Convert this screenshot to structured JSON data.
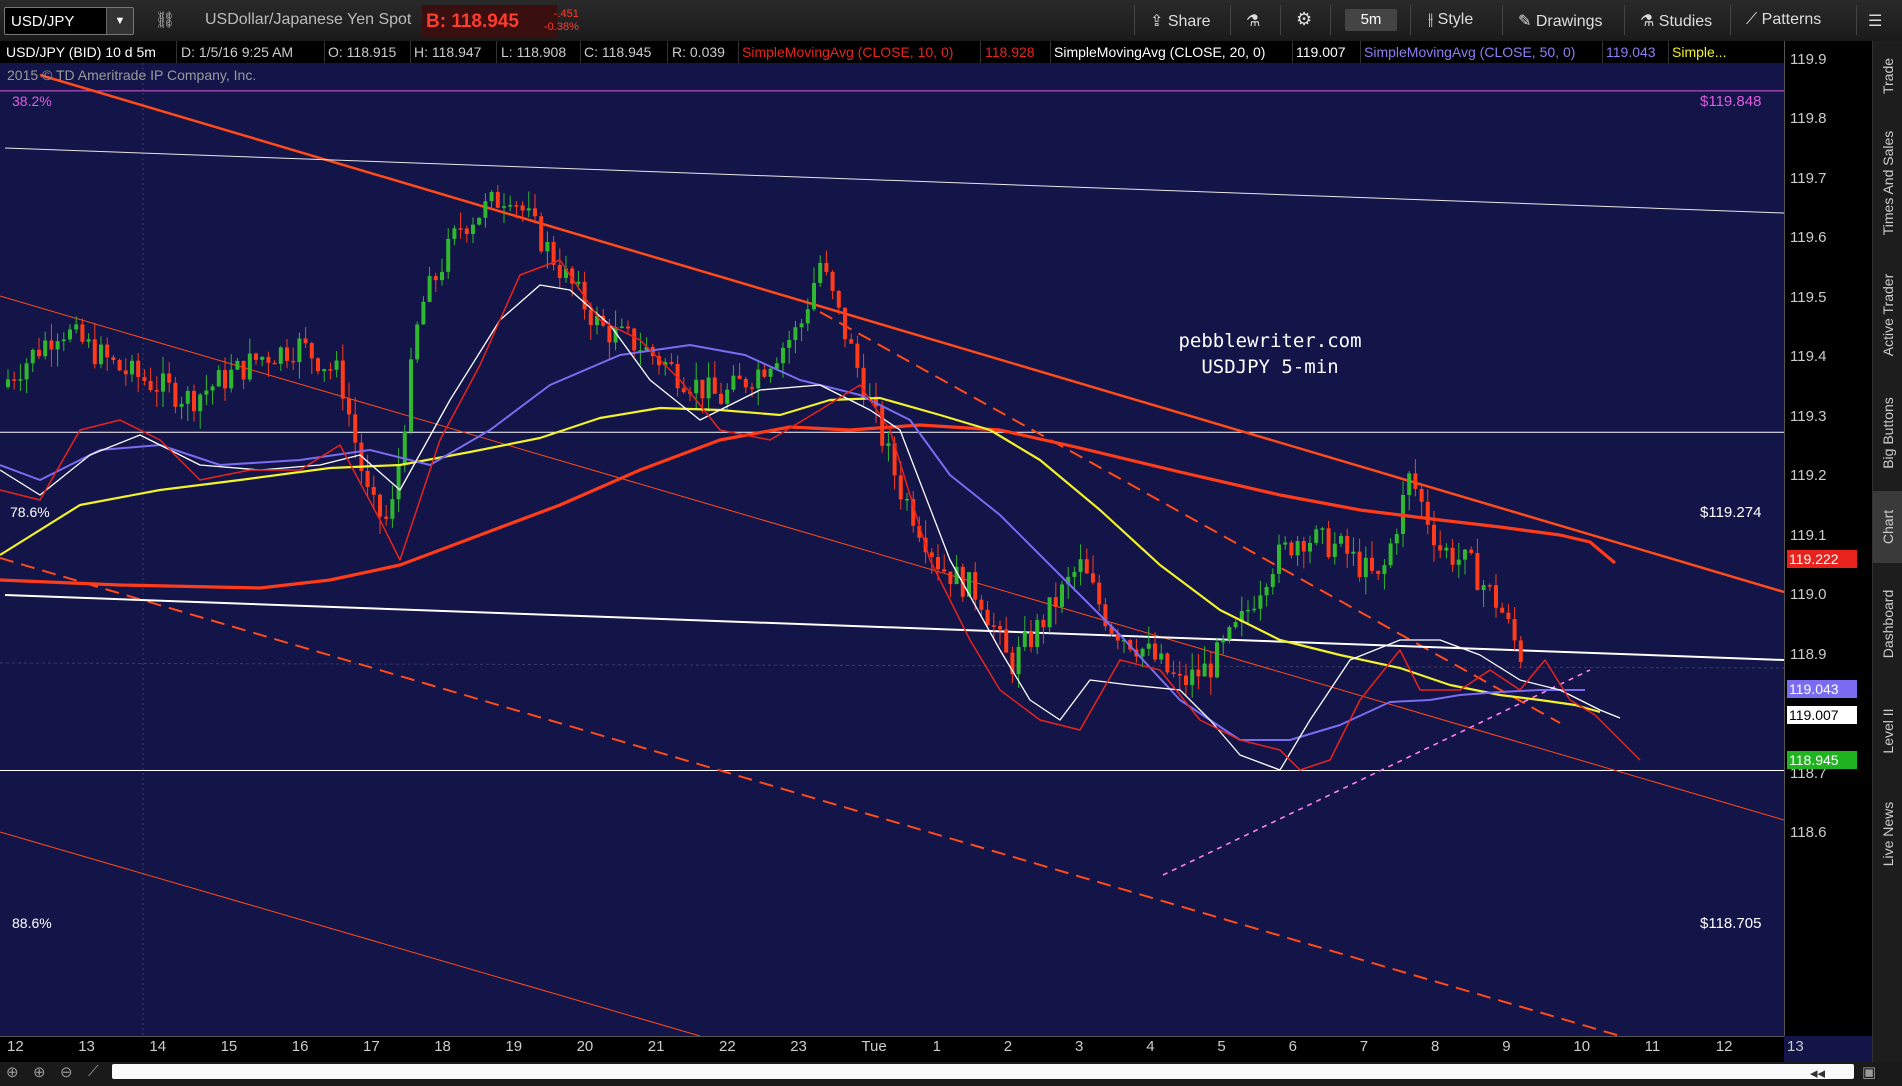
{
  "toolbar": {
    "symbol": "USD/JPY",
    "description": "USDollar/Japanese Yen Spot",
    "bid": "B: 118.945",
    "net_change": "-.451",
    "pct_change": "-0.38%",
    "share_label": "Share",
    "timeframe": "5m",
    "style_label": "Style",
    "drawings_label": "Drawings",
    "studies_label": "Studies",
    "patterns_label": "Patterns"
  },
  "info": {
    "title": "USD/JPY (BID) 10 d 5m",
    "date": "D: 1/5/16 9:25 AM",
    "open": "O: 118.915",
    "high": "H: 118.947",
    "low": "L: 118.908",
    "close": "C: 118.945",
    "range": "R: 0.039",
    "sma10_label": "SimpleMovingAvg (CLOSE, 10, 0)",
    "sma10_value": "118.928",
    "sma20_label": "SimpleMovingAvg (CLOSE, 20, 0)",
    "sma20_value": "119.007",
    "sma50_label": "SimpleMovingAvg (CLOSE, 50, 0)",
    "sma50_value": "119.043",
    "sma_more": "Simple..."
  },
  "chart": {
    "copyright": "2015 © TD Ameritrade IP Company, Inc.",
    "watermark_line1": "pebblewriter.com",
    "watermark_line2": "USDJPY 5-min",
    "fib_382_label": "38.2%",
    "fib_382_price": "$119.848",
    "fib_786_label": "78.6%",
    "fib_786_price": "$119.274",
    "fib_886_label": "88.6%",
    "fib_886_price": "$118.705"
  },
  "price_badges": {
    "sma200": "119.222",
    "sma50": "119.043",
    "sma20": "119.007",
    "last": "118.945"
  },
  "colors": {
    "background": "#131447",
    "candle_up": "#2fb82f",
    "candle_down": "#ff3b1a",
    "trend": "#ff4a1a",
    "sma10": "#e8231d",
    "sma20": "#ffffff",
    "sma50": "#7a6cf0",
    "sma100": "#f2f22a",
    "sma200": "#ff3b1a",
    "fib": "#e05be0",
    "support": "#ff7ff0"
  },
  "sidebar": [
    "Trade",
    "Times And Sales",
    "Active Trader",
    "Big Buttons",
    "Chart",
    "Dashboard",
    "Level II",
    "Live News"
  ],
  "chart_data": {
    "type": "candlestick",
    "title": "USD/JPY (BID) 10 d 5m",
    "ylim": [
      118.55,
      119.95
    ],
    "y_ticks": [
      "119.9",
      "119.8",
      "119.7",
      "119.6",
      "119.5",
      "119.4",
      "119.3",
      "119.2",
      "119.1",
      "119.0",
      "118.9",
      "118.8",
      "118.7",
      "118.6"
    ],
    "x_ticks": [
      "12",
      "13",
      "14",
      "15",
      "16",
      "17",
      "18",
      "19",
      "20",
      "21",
      "22",
      "23",
      "Tue",
      "1",
      "2",
      "3",
      "4",
      "5",
      "6",
      "7",
      "8",
      "9",
      "10",
      "11",
      "12",
      "13"
    ],
    "series": [
      {
        "name": "SimpleMovingAvg (CLOSE, 10, 0)",
        "last": 118.928
      },
      {
        "name": "SimpleMovingAvg (CLOSE, 20, 0)",
        "last": 119.007
      },
      {
        "name": "SimpleMovingAvg (CLOSE, 50, 0)",
        "last": 119.043
      },
      {
        "name": "Simple...",
        "last": 119.222
      }
    ],
    "fib_levels": [
      {
        "label": "38.2%",
        "price": 119.848
      },
      {
        "label": "78.6%",
        "price": 119.274
      },
      {
        "label": "88.6%",
        "price": 118.705
      }
    ]
  }
}
